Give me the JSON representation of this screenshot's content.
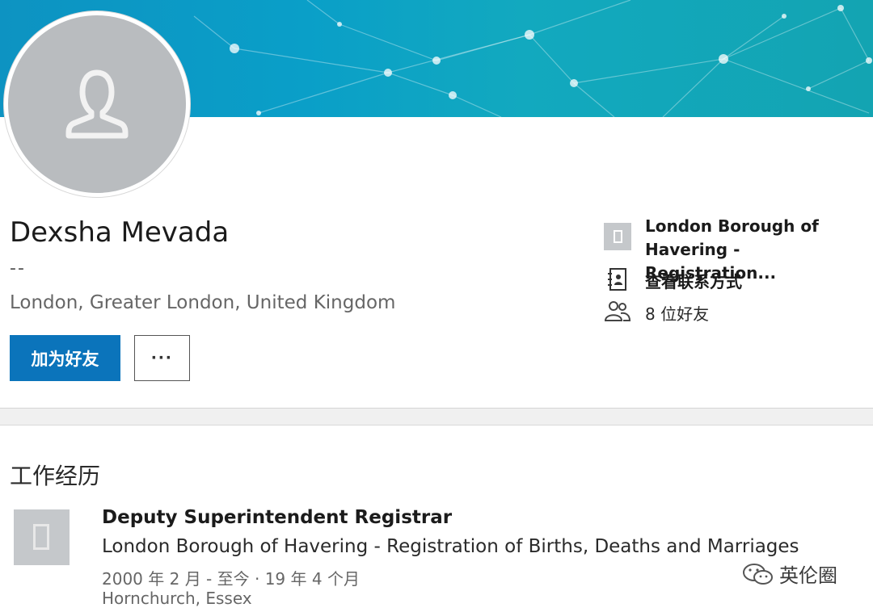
{
  "profile": {
    "name": "Dexsha Mevada",
    "headline": "--",
    "location": "London, Greater London, United Kingdom",
    "add_friend_label": "加为好友",
    "more_label": "···"
  },
  "side_panel": {
    "company": "London Borough of Havering - Registration...",
    "contact_label": "查看联系方式",
    "friends_label": "8 位好友"
  },
  "experience": {
    "section_title": "工作经历",
    "items": [
      {
        "title": "Deputy Superintendent Registrar",
        "company": "London Borough of Havering - Registration of Births, Deaths and Marriages",
        "dates": "2000 年 2 月 - 至今 · 19 年 4 个月",
        "location": "Hornchurch, Essex"
      }
    ]
  },
  "watermark": {
    "badge_text": "英伦圈"
  },
  "colors": {
    "primary_button": "#0b74bb",
    "banner": "#0a9fc8",
    "placeholder_grey": "#b9bcbf"
  }
}
